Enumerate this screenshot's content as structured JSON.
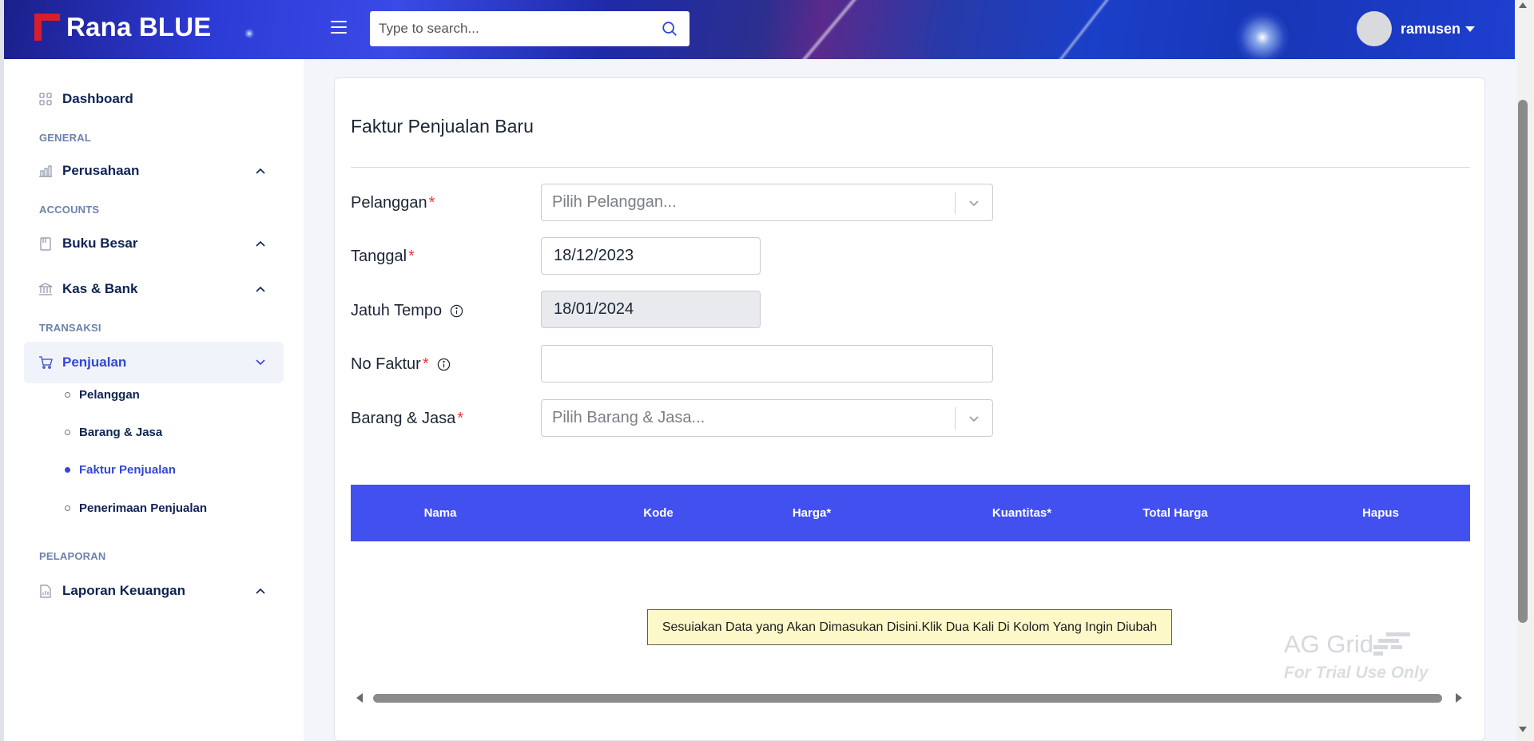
{
  "header": {
    "brand_name": "Rana BLUE",
    "search_placeholder": "Type to search...",
    "username": "ramusen",
    "brand_color": "#d61e2c"
  },
  "sidebar": {
    "dashboard": "Dashboard",
    "sections": {
      "general": "GENERAL",
      "accounts": "ACCOUNTS",
      "transaksi": "TRANSAKSI",
      "pelaporan": "PELAPORAN"
    },
    "items": {
      "perusahaan": "Perusahaan",
      "buku_besar": "Buku Besar",
      "kas_bank": "Kas & Bank",
      "penjualan": "Penjualan",
      "laporan_keuangan": "Laporan Keuangan"
    },
    "sub_items": [
      {
        "label": "Pelanggan",
        "active": false
      },
      {
        "label": "Barang & Jasa",
        "active": false
      },
      {
        "label": "Faktur Penjualan",
        "active": true
      },
      {
        "label": "Penerimaan Penjualan",
        "active": false
      }
    ],
    "accent_color": "#3346d6"
  },
  "main": {
    "title": "Faktur Penjualan Baru",
    "form": {
      "pelanggan_label": "Pelanggan",
      "pelanggan_placeholder": "Pilih Pelanggan...",
      "tanggal_label": "Tanggal",
      "tanggal_value": "18/12/2023",
      "jatuh_tempo_label": "Jatuh Tempo",
      "jatuh_tempo_value": "18/01/2024",
      "no_faktur_label": "No Faktur",
      "no_faktur_value": "",
      "barang_label": "Barang & Jasa",
      "barang_placeholder": "Pilih Barang & Jasa...",
      "required_mark": "*"
    },
    "grid": {
      "header_color": "#4350f0",
      "columns": [
        "Nama",
        "Kode",
        "Harga*",
        "Kuantitas*",
        "Total Harga",
        "Hapus"
      ],
      "overlay_message": "Sesuiakan Data yang Akan Dimasukan Disini.Klik Dua Kali Di Kolom Yang Ingin Diubah",
      "watermark_line1": "AG Grid",
      "watermark_line2": "For Trial Use Only"
    }
  }
}
